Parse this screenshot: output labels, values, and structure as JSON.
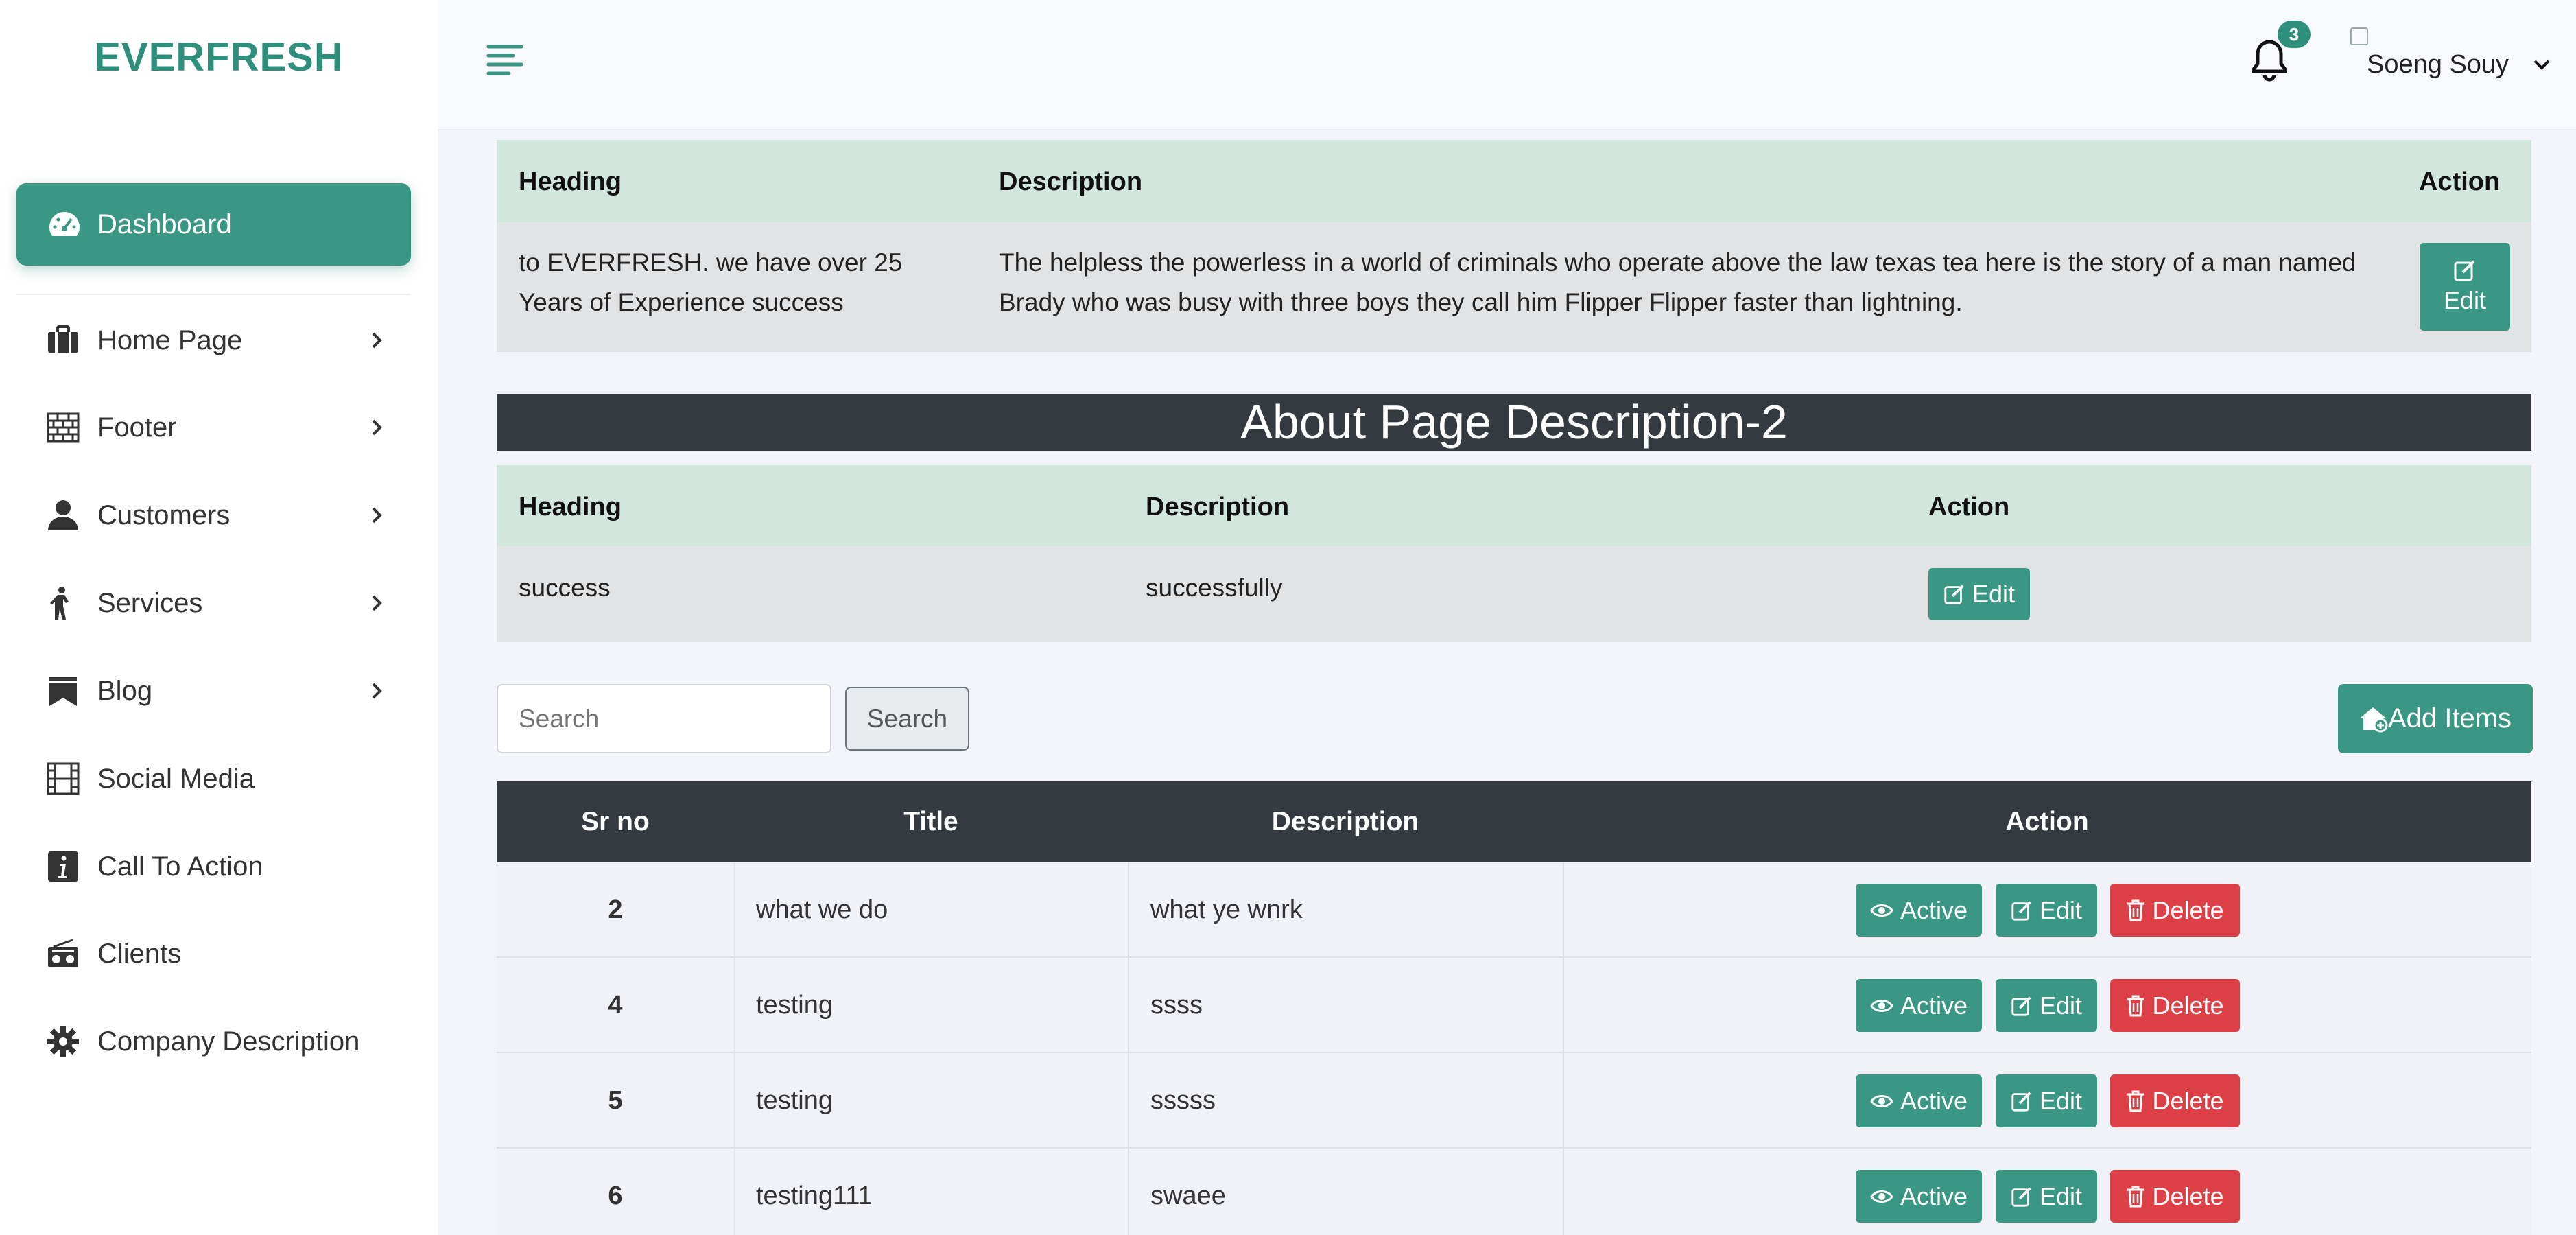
{
  "brand": "EVERFRESH",
  "sidebar": {
    "active": {
      "label": "Dashboard",
      "icon": "gauge-icon"
    },
    "items": [
      {
        "label": "Home Page",
        "icon": "briefcase-icon",
        "has_submenu": true
      },
      {
        "label": "Footer",
        "icon": "brick-wall-icon",
        "has_submenu": true
      },
      {
        "label": "Customers",
        "icon": "user-icon",
        "has_submenu": true
      },
      {
        "label": "Services",
        "icon": "person-walking-icon",
        "has_submenu": true
      },
      {
        "label": "Blog",
        "icon": "bookmark-icon",
        "has_submenu": true
      },
      {
        "label": "Social Media",
        "icon": "film-icon",
        "has_submenu": false
      },
      {
        "label": "Call To Action",
        "icon": "info-icon",
        "has_submenu": false
      },
      {
        "label": "Clients",
        "icon": "radio-icon",
        "has_submenu": false
      },
      {
        "label": "Company Description",
        "icon": "gear-icon",
        "has_submenu": false
      }
    ]
  },
  "topbar": {
    "notifications": "3",
    "username": "Soeng Souy"
  },
  "about1": {
    "headers": {
      "heading": "Heading",
      "description": "Description",
      "action": "Action"
    },
    "row": {
      "heading": "to EVERFRESH. we have over 25 Years of Experience success",
      "description": "The helpless the powerless in a world of criminals who operate above the law texas tea here is the story of a man named Brady who was busy with three boys they call him Flipper Flipper faster than lightning.",
      "edit": "Edit"
    }
  },
  "about2": {
    "title": "About Page Description-2",
    "headers": {
      "heading": "Heading",
      "description": "Description",
      "action": "Action"
    },
    "row": {
      "heading": "success",
      "description": "successfully",
      "edit": "Edit"
    }
  },
  "search": {
    "placeholder": "Search",
    "button": "Search"
  },
  "add_items": "Add Items",
  "table": {
    "headers": [
      "Sr no",
      "Title",
      "Description",
      "Action"
    ],
    "rows": [
      {
        "sr": "2",
        "title": "what we do",
        "description": "what ye wnrk"
      },
      {
        "sr": "4",
        "title": "testing",
        "description": "ssss"
      },
      {
        "sr": "5",
        "title": "testing",
        "description": "sssss"
      },
      {
        "sr": "6",
        "title": "testing111",
        "description": "swaee"
      }
    ],
    "actions": {
      "active": "Active",
      "edit": "Edit",
      "delete": "Delete"
    }
  },
  "colors": {
    "accent": "#3a9783",
    "danger": "#dc3f45",
    "dark": "#343a40",
    "green_head": "#d1e7dd"
  }
}
